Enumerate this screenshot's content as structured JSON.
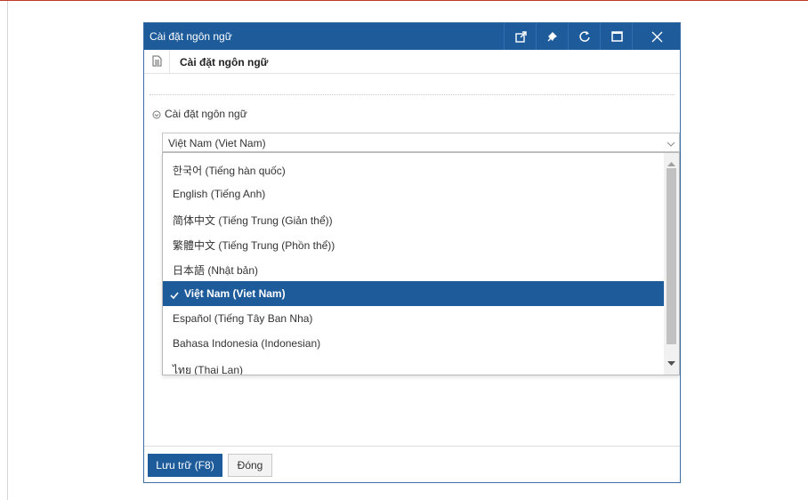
{
  "dialog": {
    "title": "Cài đặt ngôn ngữ",
    "subtitle": "Cài đặt ngôn ngữ",
    "section_label": "Cài đặt ngôn ngữ",
    "window_buttons": [
      "external-link-icon",
      "pin-icon",
      "refresh-icon",
      "maximize-icon",
      "close-icon"
    ]
  },
  "language_select": {
    "value": "Việt Nam (Viet Nam)",
    "options": [
      "한국어 (Tiếng hàn quốc)",
      "English (Tiếng Anh)",
      "简体中文 (Tiếng Trung (Giản thể))",
      "繁體中文 (Tiếng Trung (Phồn thể))",
      "日本語 (Nhật bản)",
      "Việt Nam (Viet Nam)",
      "Español (Tiếng Tây Ban Nha)",
      "Bahasa Indonesia (Indonesian)",
      "ไทย (Thai Lan)"
    ],
    "selected_index": 5
  },
  "footer": {
    "save_label": "Lưu trữ (F8)",
    "close_label": "Đóng"
  },
  "colors": {
    "primary": "#1d5b9b",
    "accent_line": "#c0392b"
  }
}
